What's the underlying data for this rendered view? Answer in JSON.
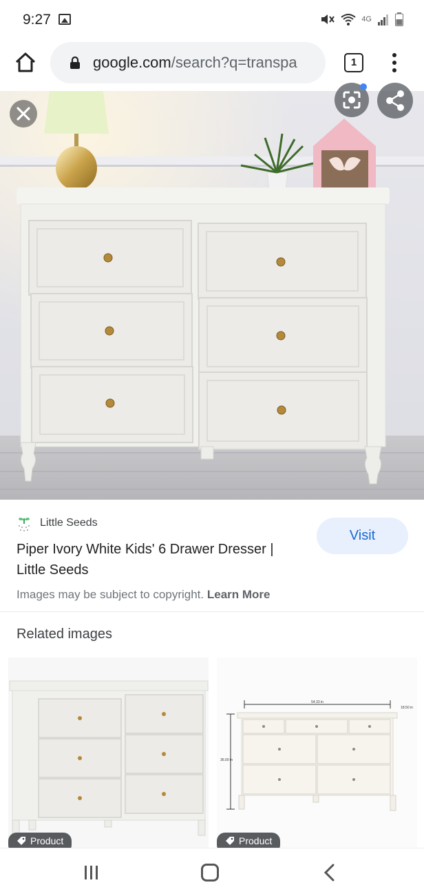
{
  "status_bar": {
    "time": "9:27",
    "icons": [
      "gallery-icon",
      "mute-icon",
      "wifi-icon",
      "lte-icon",
      "signal-icon",
      "battery-icon"
    ],
    "network_label": "4G"
  },
  "browser": {
    "url_host": "google.com",
    "url_rest": "/search?q=transpa",
    "tab_count": "1"
  },
  "result": {
    "source": "Little Seeds",
    "title": "Piper Ivory White Kids' 6 Drawer Dresser | Little Seeds",
    "visit_label": "Visit",
    "copyright_text": "Images may be subject to copyright.",
    "learn_more": "Learn More"
  },
  "related": {
    "heading": "Related images",
    "items": [
      {
        "badge": "Product"
      },
      {
        "badge": "Product"
      }
    ],
    "dimension_labels": [
      "54.33 in",
      "18.50 in",
      "36.00 in"
    ]
  },
  "colors": {
    "visit_bg": "#e8f0fe",
    "visit_text": "#1967d2",
    "url_pill": "#f1f3f4"
  }
}
